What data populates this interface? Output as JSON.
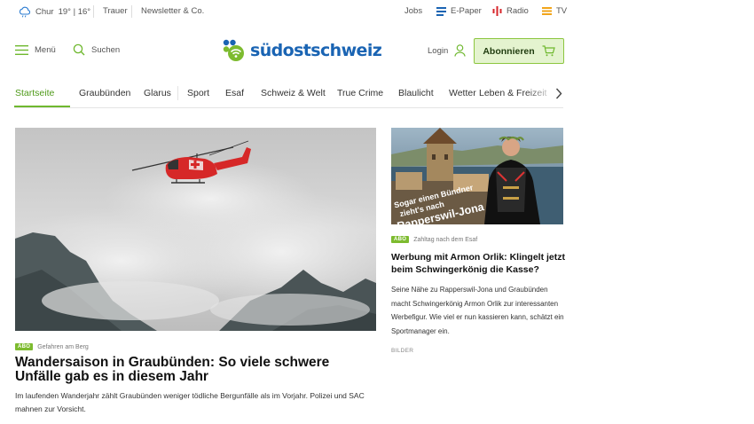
{
  "topbar": {
    "weather_city": "Chur",
    "weather_temps": "19° | 16°",
    "links": [
      "Trauer",
      "Newsletter & Co."
    ],
    "right_links": [
      "Jobs",
      "E-Paper",
      "Radio",
      "TV"
    ]
  },
  "header": {
    "menu_label": "Menü",
    "search_label": "Suchen",
    "logo_text": "südostschweiz",
    "login_label": "Login",
    "subscribe_label": "Abonnieren"
  },
  "nav": {
    "items": [
      "Startseite",
      "Graubünden",
      "Glarus",
      "Sport",
      "Esaf",
      "Schweiz & Welt",
      "True Crime",
      "Blaulicht",
      "Wetter",
      "Leben & Freizeit"
    ]
  },
  "main_article": {
    "badge": "ABO",
    "kicker": "Gefahren am Berg",
    "title": "Wandersaison in Graubünden: So viele schwere Unfälle gab es in diesem Jahr",
    "lead": "Im laufenden Wanderjahr zählt Graubünden weniger tödliche Bergunfälle als im Vorjahr. Polizei und SAC mahnen zur Vorsicht."
  },
  "side_article": {
    "image_caption_line1": "Sogar einen Bündner",
    "image_caption_line2": "zieht's nach",
    "image_caption_line3": "Rapperswil-Jona",
    "badge": "ABO",
    "kicker": "Zahltag nach dem Esaf",
    "title": "Werbung mit Armon Orlik: Klingelt jetzt beim Schwingerkönig die Kasse?",
    "lead": "Seine Nähe zu Rapperswil-Jona und Graubünden macht Schwingerkönig Armon Orlik zur interessanten Werbefigur. Wie viel er nun kassieren kann, schätzt ein Sportmanager ein.",
    "meta": "BILDER"
  },
  "colors": {
    "brand_blue": "#1a64b3",
    "brand_green": "#7dbb2f",
    "subscribe_bg": "#e4f3cf"
  }
}
